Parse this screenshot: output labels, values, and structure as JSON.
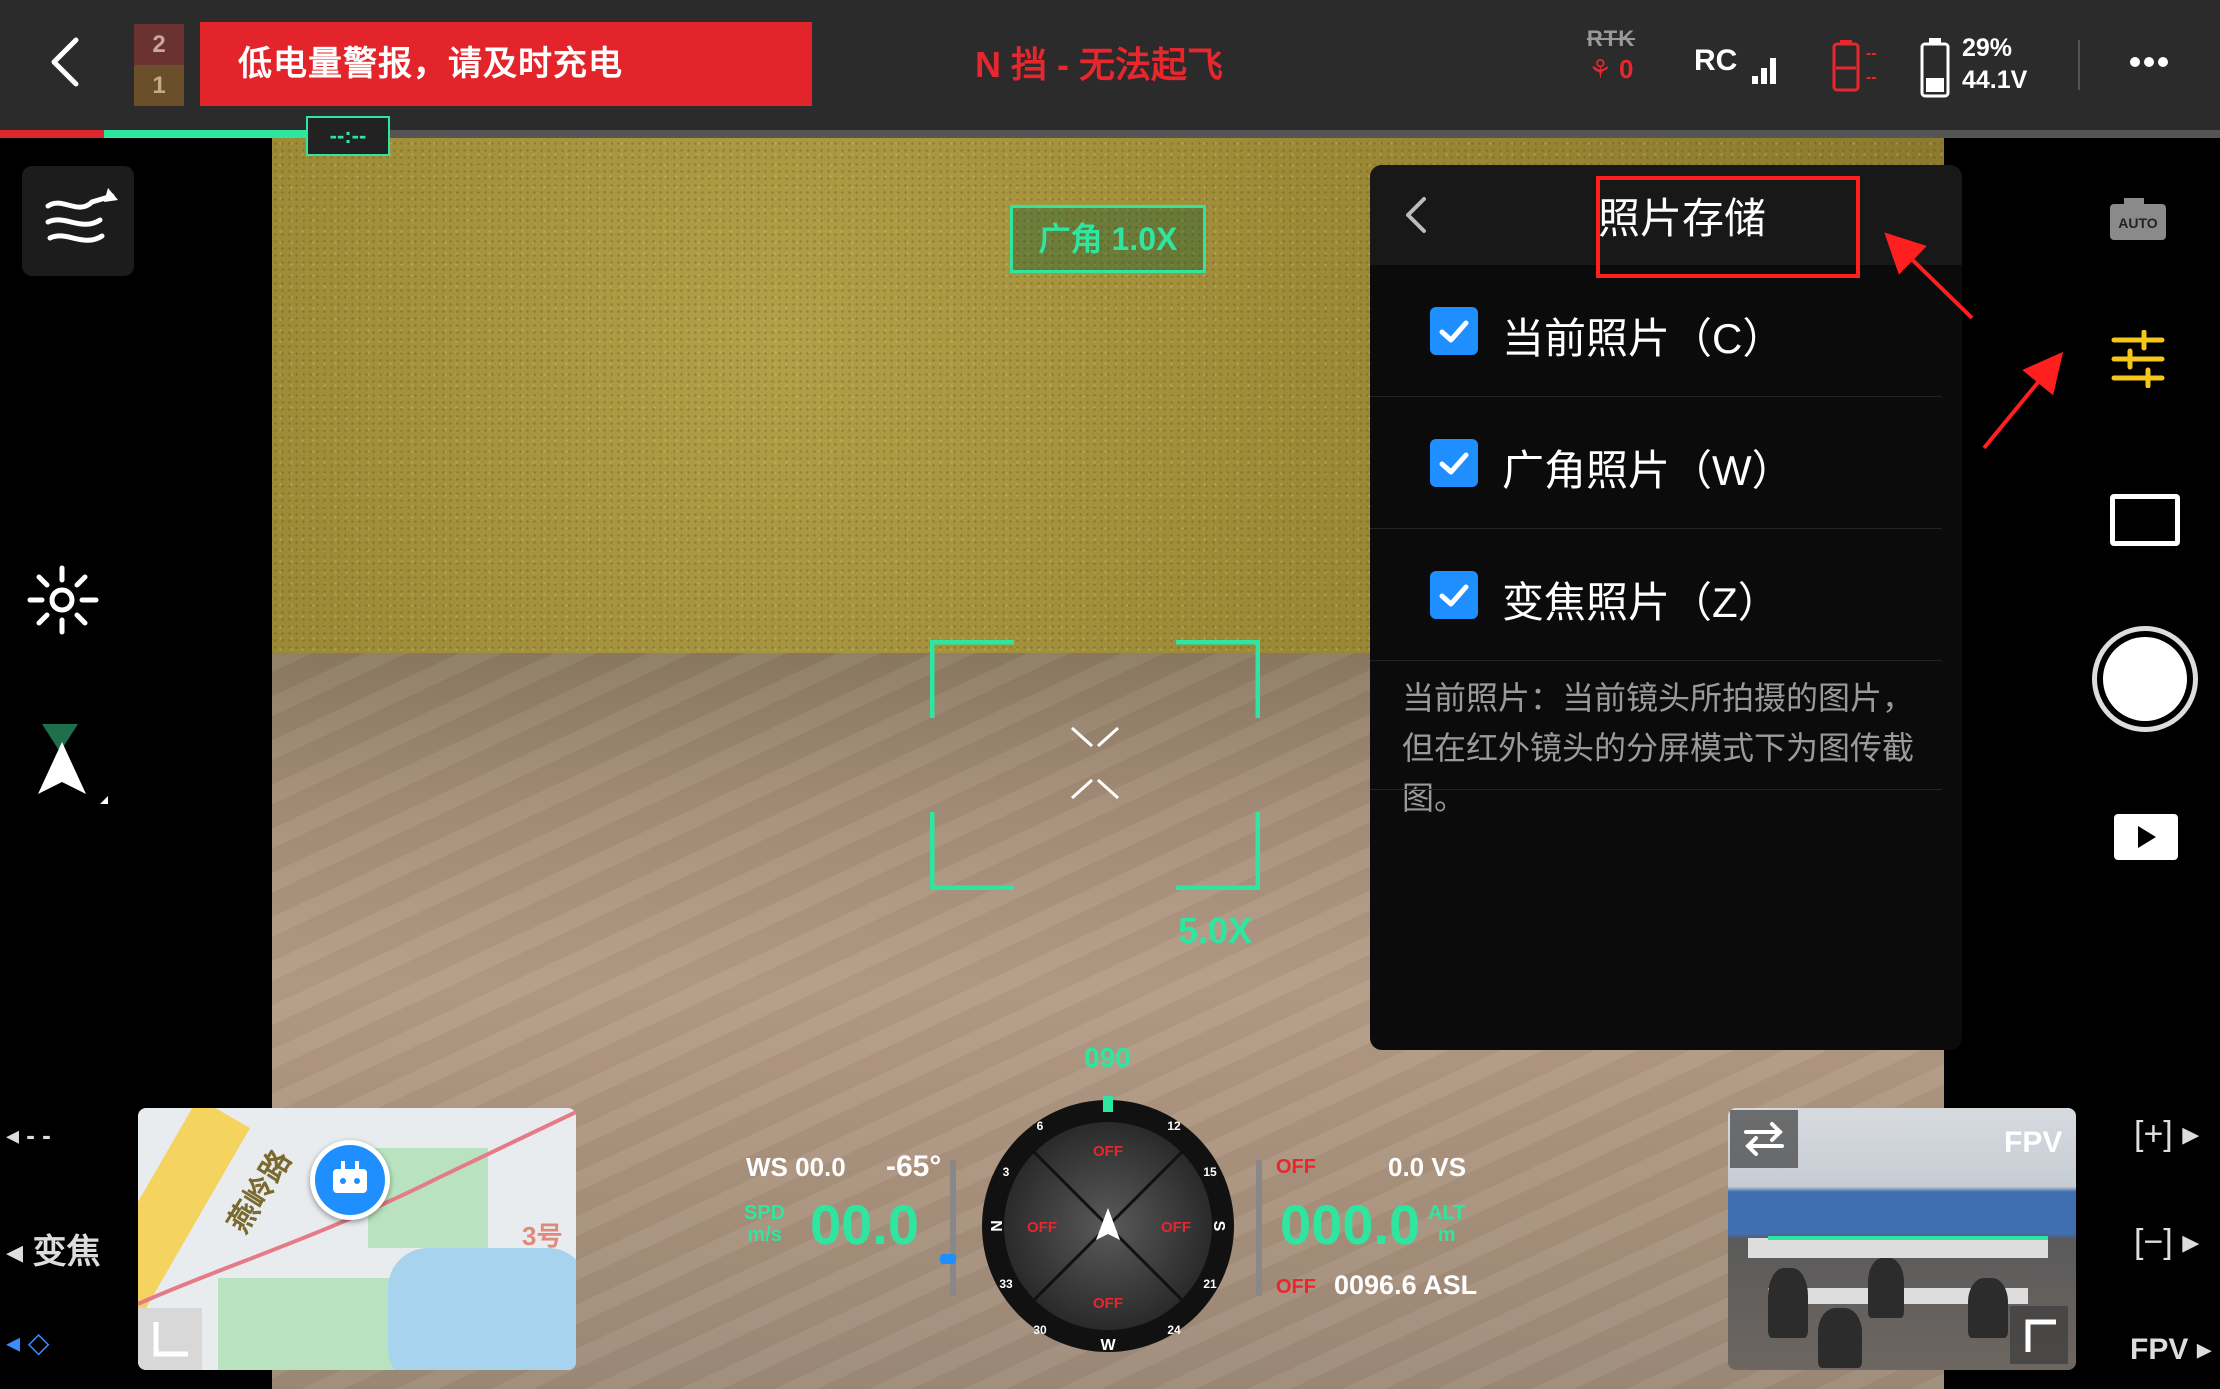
{
  "top_bar": {
    "gear_upper": "2",
    "gear_lower": "1",
    "battery_warning": "低电量警报，请及时充电",
    "flight_status": "N 挡 - 无法起飞",
    "rtk_label": "RTK",
    "rtk_value": "0",
    "rc_label": "RC",
    "rc_battery_dashes": "--",
    "battery_percent": "29%",
    "battery_voltage": "44.1V",
    "progress_tag": "--:--"
  },
  "camera": {
    "lens_label": "广角 1.0X",
    "zoom_value": "5.0X"
  },
  "settings_panel": {
    "title": "照片存储",
    "options": [
      {
        "label": "当前照片（C）",
        "checked": true
      },
      {
        "label": "广角照片（W）",
        "checked": true
      },
      {
        "label": "变焦照片（Z）",
        "checked": true
      }
    ],
    "description": "当前照片：当前镜头所拍摄的图片，但在红外镜头的分屏模式下为图传截图。"
  },
  "left_bar": {
    "dash_label": "- -",
    "zoom_label": "变焦"
  },
  "right_bar": {
    "auto_label": "AUTO",
    "zoom_in_label": "[+]",
    "zoom_out_label": "[−]",
    "fpv_label": "FPV"
  },
  "map": {
    "road_label": "燕岭路",
    "building_label": "3号"
  },
  "telemetry": {
    "ws_label": "WS 00.0",
    "pitch": "-65°",
    "spd_unit": "SPD",
    "spd_unit2": "m/s",
    "speed": "00.0",
    "vs_label": "0.0  VS",
    "off_label": "OFF",
    "altitude": "000.0",
    "alt_unit": "ALT",
    "alt_unit2": "m",
    "asl": "0096.6 ASL",
    "heading": "090",
    "compass_n": "N",
    "compass_s": "S",
    "compass_w": "W",
    "compass_off": "OFF",
    "compass_ticks": [
      "3",
      "6",
      "12",
      "15",
      "21",
      "24",
      "30",
      "33"
    ]
  },
  "fpv": {
    "title": "FPV"
  },
  "colors": {
    "accent_green": "#2ee6a0",
    "warning_red": "#e3242b",
    "checkbox_blue": "#1f8fff",
    "annotation_red": "#ff1f1f"
  },
  "icons": {
    "back": "chevron-left-icon",
    "more": "ellipsis-icon",
    "route": "route-icon",
    "exposure": "exposure-icon",
    "nav": "navigation-arrow-icon",
    "camera": "camera-auto-icon",
    "settings": "sliders-icon",
    "display": "display-mode-icon",
    "shutter": "shutter-icon",
    "play": "play-icon"
  }
}
